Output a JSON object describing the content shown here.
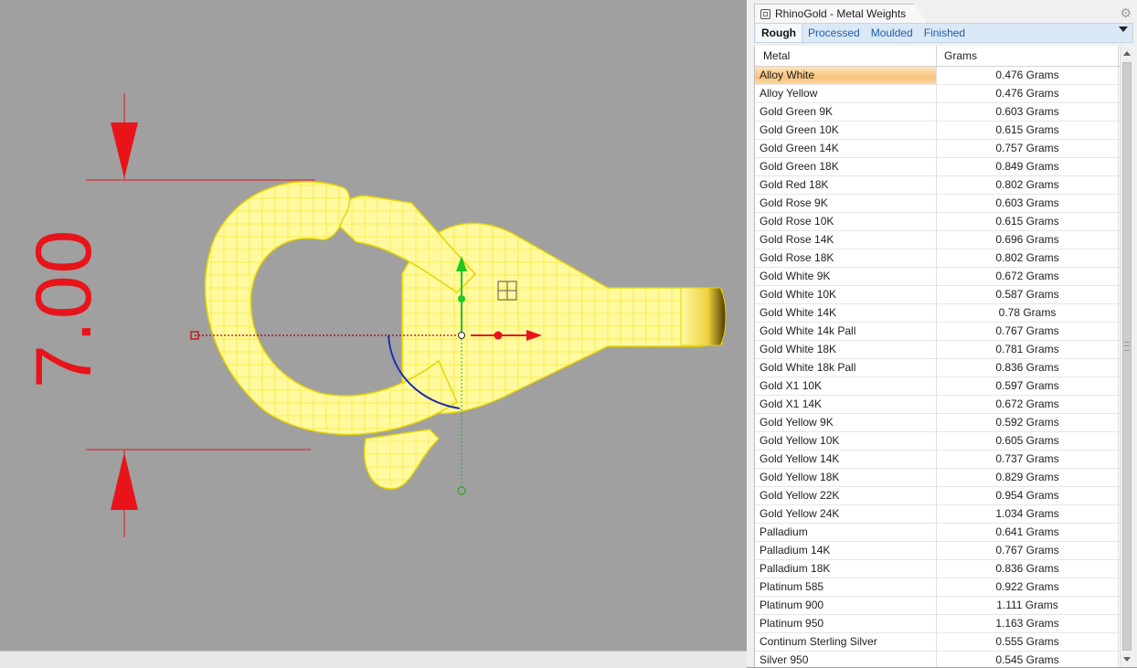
{
  "viewport": {
    "dimension_text": "7.00",
    "colors": {
      "dimension": "#e8141a",
      "part_fill": "#fffaa0",
      "part_wire": "#f2e200",
      "background": "#a0a0a0"
    }
  },
  "panel": {
    "title": "RhinoGold - Metal Weights",
    "icons": {
      "app": "rhinogold-icon",
      "settings": "gear-icon",
      "dropdown": "chevron-down-icon"
    },
    "tabs": [
      "Rough",
      "Processed",
      "Moulded",
      "Finished"
    ],
    "active_tab": "Rough",
    "columns": {
      "metal": "Metal",
      "grams": "Grams"
    },
    "rows": [
      {
        "metal": "Alloy White",
        "grams": "0.476 Grams"
      },
      {
        "metal": "Alloy Yellow",
        "grams": "0.476 Grams"
      },
      {
        "metal": "Gold Green 9K",
        "grams": "0.603 Grams"
      },
      {
        "metal": "Gold Green 10K",
        "grams": "0.615 Grams"
      },
      {
        "metal": "Gold Green 14K",
        "grams": "0.757 Grams"
      },
      {
        "metal": "Gold Green 18K",
        "grams": "0.849 Grams"
      },
      {
        "metal": "Gold Red 18K",
        "grams": "0.802 Grams"
      },
      {
        "metal": "Gold Rose 9K",
        "grams": "0.603 Grams"
      },
      {
        "metal": "Gold Rose 10K",
        "grams": "0.615 Grams"
      },
      {
        "metal": "Gold Rose 14K",
        "grams": "0.696 Grams"
      },
      {
        "metal": "Gold Rose 18K",
        "grams": "0.802 Grams"
      },
      {
        "metal": "Gold White 9K",
        "grams": "0.672 Grams"
      },
      {
        "metal": "Gold White 10K",
        "grams": "0.587 Grams"
      },
      {
        "metal": "Gold White 14K",
        "grams": "0.78 Grams"
      },
      {
        "metal": "Gold White 14k Pall",
        "grams": "0.767 Grams"
      },
      {
        "metal": "Gold White 18K",
        "grams": "0.781 Grams"
      },
      {
        "metal": "Gold White 18k Pall",
        "grams": "0.836 Grams"
      },
      {
        "metal": "Gold X1 10K",
        "grams": "0.597 Grams"
      },
      {
        "metal": "Gold X1 14K",
        "grams": "0.672 Grams"
      },
      {
        "metal": "Gold Yellow 9K",
        "grams": "0.592 Grams"
      },
      {
        "metal": "Gold Yellow 10K",
        "grams": "0.605 Grams"
      },
      {
        "metal": "Gold Yellow 14K",
        "grams": "0.737 Grams"
      },
      {
        "metal": "Gold Yellow 18K",
        "grams": "0.829 Grams"
      },
      {
        "metal": "Gold Yellow 22K",
        "grams": "0.954 Grams"
      },
      {
        "metal": "Gold Yellow 24K",
        "grams": "1.034 Grams"
      },
      {
        "metal": "Palladium",
        "grams": "0.641 Grams"
      },
      {
        "metal": "Palladium 14K",
        "grams": "0.767 Grams"
      },
      {
        "metal": "Palladium 18K",
        "grams": "0.836 Grams"
      },
      {
        "metal": "Platinum 585",
        "grams": "0.922 Grams"
      },
      {
        "metal": "Platinum 900",
        "grams": "1.111 Grams"
      },
      {
        "metal": "Platinum 950",
        "grams": "1.163 Grams"
      },
      {
        "metal": "Continum Sterling Silver",
        "grams": "0.555 Grams"
      },
      {
        "metal": "Silver 950",
        "grams": "0.545 Grams"
      }
    ],
    "selected_row": "Alloy White"
  }
}
